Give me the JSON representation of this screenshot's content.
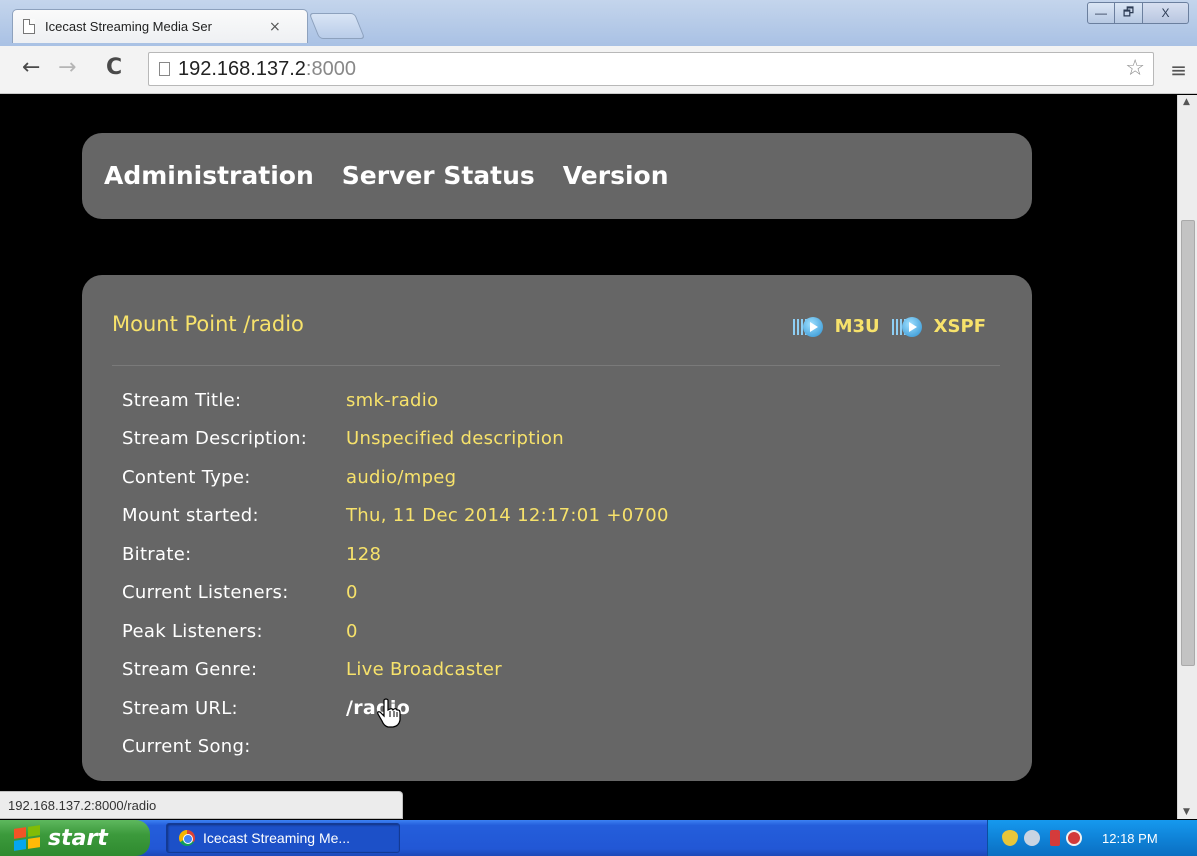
{
  "browser": {
    "tab_title": "Icecast Streaming Media Ser",
    "tab_close": "×",
    "url_host": "192.168.137.2",
    "url_port": ":8000",
    "window_buttons": {
      "minimize": "—",
      "maximize": "🗗",
      "close": "X"
    },
    "status_url": "192.168.137.2:8000/radio"
  },
  "nav": {
    "items": [
      {
        "label": "Administration"
      },
      {
        "label": "Server Status"
      },
      {
        "label": "Version"
      }
    ]
  },
  "mount": {
    "title": "Mount Point /radio",
    "playlist_links": [
      {
        "label": "M3U",
        "icon": "play-icon"
      },
      {
        "label": "XSPF",
        "icon": "play-icon"
      }
    ],
    "stats": [
      {
        "label": "Stream Title:",
        "value": "smk-radio"
      },
      {
        "label": "Stream Description:",
        "value": "Unspecified description"
      },
      {
        "label": "Content Type:",
        "value": "audio/mpeg"
      },
      {
        "label": "Mount started:",
        "value": "Thu, 11 Dec 2014 12:17:01 +0700"
      },
      {
        "label": "Bitrate:",
        "value": "128"
      },
      {
        "label": "Current Listeners:",
        "value": "0"
      },
      {
        "label": "Peak Listeners:",
        "value": "0"
      },
      {
        "label": "Stream Genre:",
        "value": "Live Broadcaster"
      },
      {
        "label": "Stream URL:",
        "value": "/radio"
      },
      {
        "label": "Current Song:",
        "value": ""
      }
    ]
  },
  "taskbar": {
    "start_label": "start",
    "task_label": "Icecast Streaming Me...",
    "clock": "12:18 PM"
  },
  "colors": {
    "accent_yellow": "#f7e26b",
    "panel_gray": "#666666",
    "page_bg": "#000000"
  }
}
